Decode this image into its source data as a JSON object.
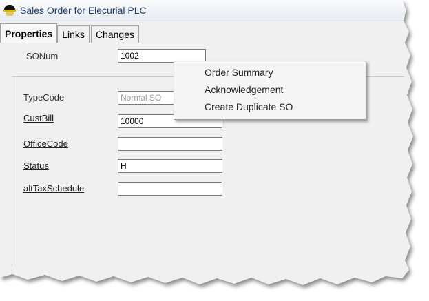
{
  "window": {
    "title": "Sales Order for Elecurial PLC",
    "icon": "hat-icon"
  },
  "tabs": [
    {
      "label": "Properties",
      "active": true
    },
    {
      "label": "Links",
      "active": false
    },
    {
      "label": "Changes",
      "active": false
    }
  ],
  "fields": {
    "sonum": {
      "label": "SONum",
      "value": "1002"
    },
    "typecode": {
      "label": "TypeCode",
      "value": "Normal SO"
    },
    "custbill": {
      "label": "CustBill",
      "value": "10000"
    },
    "officecode": {
      "label": "OfficeCode",
      "value": ""
    },
    "status": {
      "label": "Status",
      "value": "H"
    },
    "alttaxschedule": {
      "label": "altTaxSchedule",
      "value": ""
    }
  },
  "context_menu": {
    "items": [
      {
        "label": "Order Summary"
      },
      {
        "label": "Acknowledgement"
      },
      {
        "label": "Create Duplicate SO"
      }
    ]
  },
  "colors": {
    "title_text": "#1e3b70",
    "window_bg": "#f0f0f0"
  }
}
